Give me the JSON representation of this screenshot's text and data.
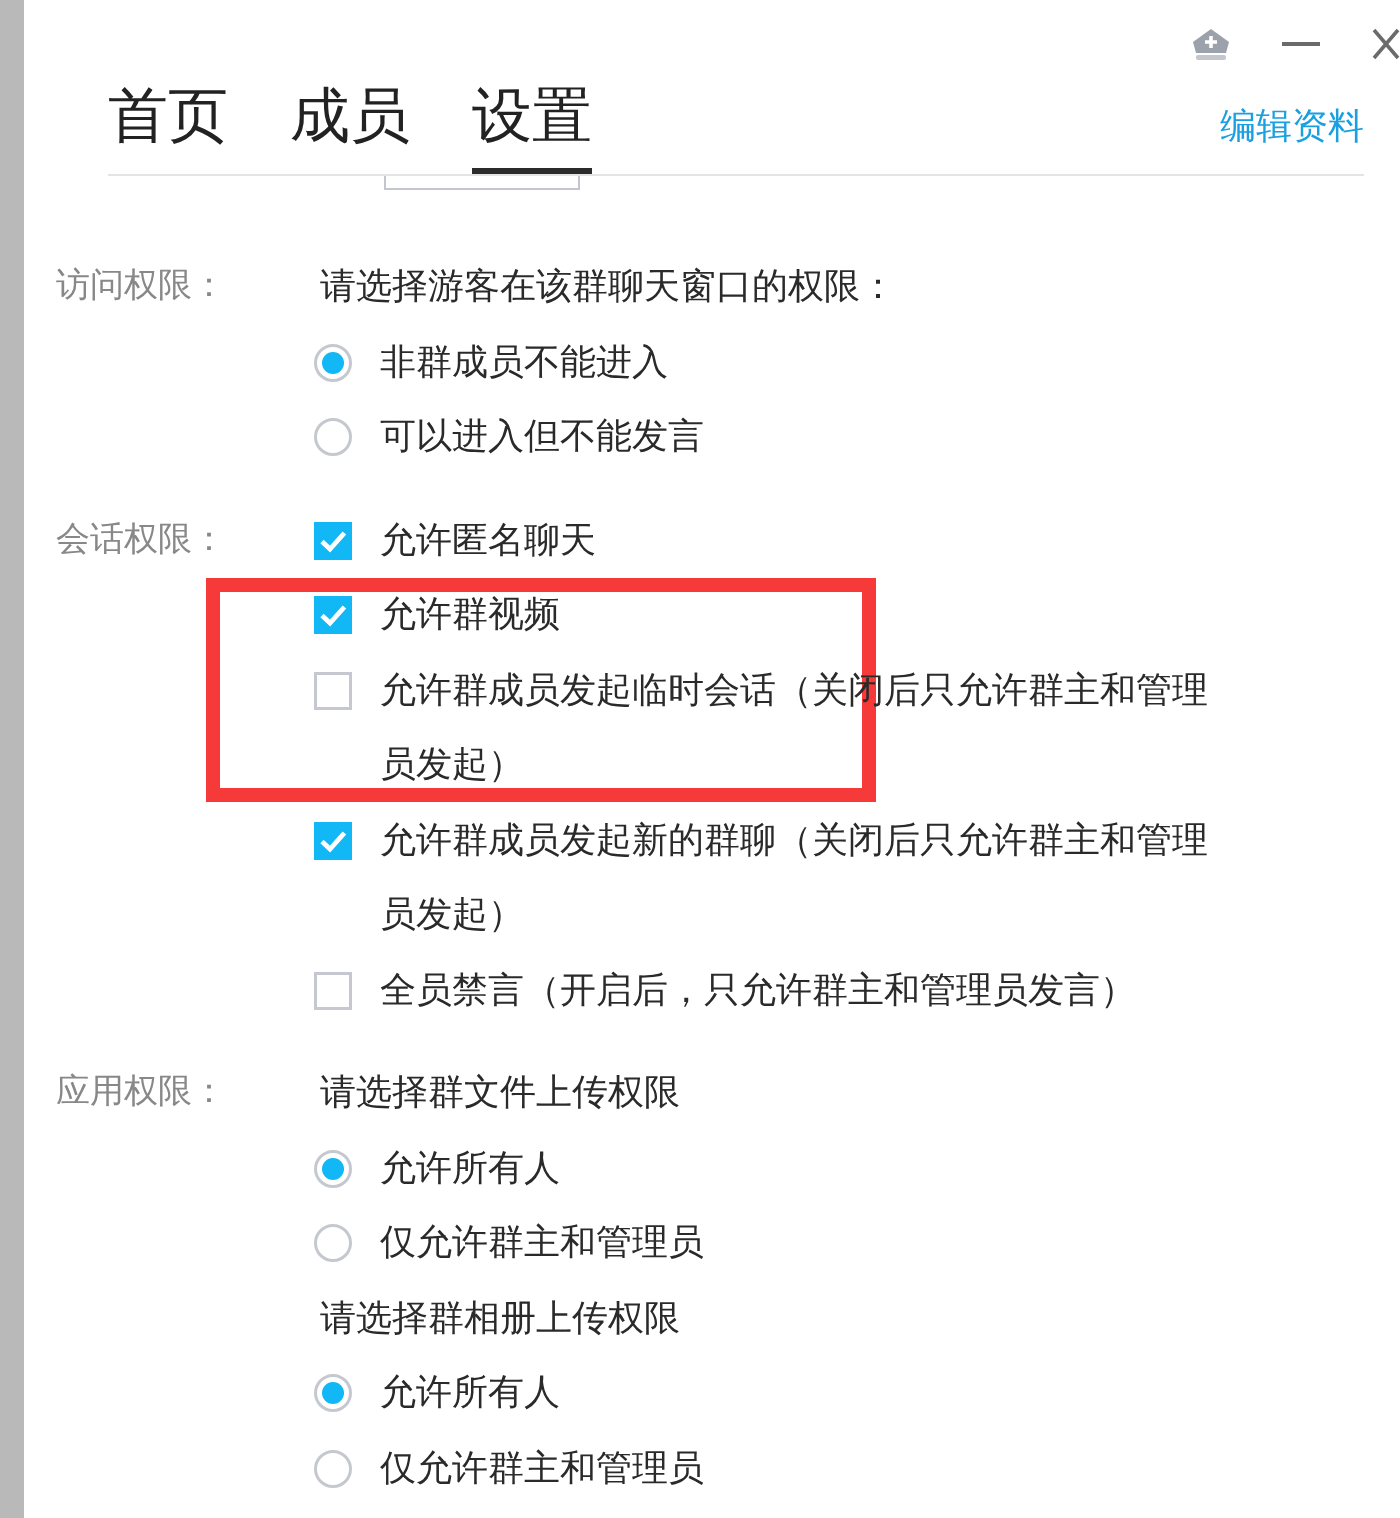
{
  "tabs": [
    {
      "label": "首页",
      "selected": false
    },
    {
      "label": "成员",
      "selected": false
    },
    {
      "label": "设置",
      "selected": true
    }
  ],
  "edit_link": "编辑资料",
  "sections": [
    {
      "label": "访问权限：",
      "items": [
        {
          "kind": "prompt",
          "text": "请选择游客在该群聊天窗口的权限："
        },
        {
          "kind": "radio",
          "text": "非群成员不能进入",
          "selected": true
        },
        {
          "kind": "radio",
          "text": "可以进入但不能发言",
          "selected": false
        }
      ]
    },
    {
      "label": "会话权限：",
      "items": [
        {
          "kind": "checkbox",
          "text": "允许匿名聊天",
          "checked": true
        },
        {
          "kind": "checkbox",
          "text": "允许群视频",
          "checked": true
        },
        {
          "kind": "checkbox",
          "text": "允许群成员发起临时会话（关闭后只允许群主和管理员发起）",
          "checked": false
        },
        {
          "kind": "checkbox",
          "text": "允许群成员发起新的群聊（关闭后只允许群主和管理员发起）",
          "checked": true
        },
        {
          "kind": "checkbox",
          "text": "全员禁言（开启后，只允许群主和管理员发言）",
          "checked": false
        }
      ]
    },
    {
      "label": "应用权限：",
      "items": [
        {
          "kind": "prompt",
          "text": "请选择群文件上传权限"
        },
        {
          "kind": "radio",
          "text": "允许所有人",
          "selected": true
        },
        {
          "kind": "radio",
          "text": "仅允许群主和管理员",
          "selected": false
        },
        {
          "kind": "prompt",
          "text": "请选择群相册上传权限"
        },
        {
          "kind": "radio",
          "text": "允许所有人",
          "selected": true
        },
        {
          "kind": "radio",
          "text": "仅允许群主和管理员",
          "selected": false
        }
      ]
    }
  ],
  "annotation": {
    "kind": "rectangle"
  }
}
